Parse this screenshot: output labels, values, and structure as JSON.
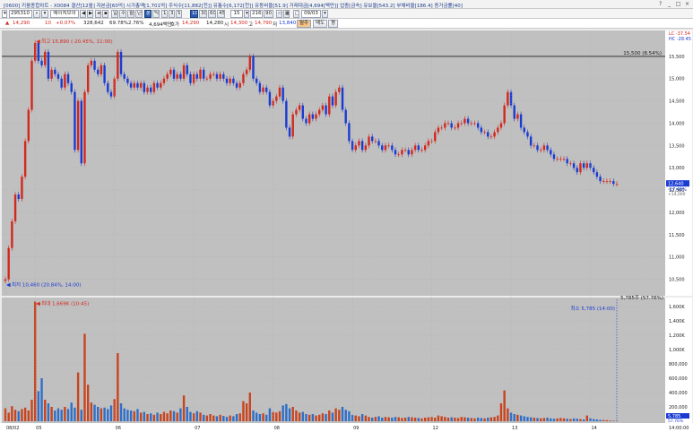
{
  "header": {
    "info_text": "[0600] 키움종합차트 - X0084 결산[12월] 자본금[60억] 시가총액[1,701억] 주식수[11,882[천]] 유통수[6,172[천]] 유동비율[51.9] 거래대금[4,694[백만]] 업종[금속] 유보율[543.2] 부채비율[186.4] 증거금률[40]",
    "buttons": [
      "?",
      "_",
      "□",
      "×"
    ]
  },
  "toolbar": {
    "code": "295310",
    "name_button": "에이치브이",
    "timeframes": [
      "1",
      "3",
      "5",
      "10",
      "30",
      "60",
      "45",
      "15"
    ],
    "interval_value": "15",
    "count_value": "216",
    "unit_label": "90",
    "date_value": "09/03"
  },
  "quote": {
    "price": "14,290",
    "change": "10",
    "change_rate": "+0.07%",
    "volume": "328,642",
    "volume_rate": "69.78%",
    "turnover": "2.76%",
    "amount": "4,694백만",
    "amount_label": "호가",
    "open": "14,290",
    "high_label": "14,280",
    "sise_label": "시",
    "s_value": "14,300",
    "h_label": "고",
    "h_value": "14,790",
    "l_label": "저",
    "l_value": "13,840",
    "btn_orange": "월주",
    "btn_a": "매도",
    "btn_b": "평"
  },
  "price_axis": {
    "ticks": [
      "15,500",
      "15,000",
      "14,500",
      "14,000",
      "13,500",
      "13,000",
      "12,500",
      "12,000",
      "11,500",
      "11,000",
      "10,500"
    ],
    "current_label": "12,640",
    "current_rate": "-17.48%",
    "current_sub": "+14,000",
    "lc_label": "LC -37.54",
    "hc_label": "HC -28.45"
  },
  "volume_axis": {
    "ticks": [
      "1,600K",
      "1,400K",
      "1,200K",
      "1,000K",
      "800,000",
      "600,000",
      "400,000",
      "200,000"
    ],
    "current_label": "5,785",
    "current_rate": "57.76%"
  },
  "annotations": {
    "high": "최고 15,890 (-20.45%, 11:00)",
    "low": "최저 10,460 (20.84%, 14:00)",
    "line_level": "15,500 (8.54%)",
    "vol_max": "최대 1,669K (10:45)",
    "vol_min": "최소 5,785 (14:00)",
    "vol_top_right": "5,785주 (57.76%)"
  },
  "x_axis": {
    "labels": [
      "08/02",
      "05",
      "06",
      "07",
      "08",
      "09",
      "12",
      "13",
      "14"
    ],
    "time_label": "14:00:00"
  },
  "chart_data": {
    "type": "candlestick",
    "title": "",
    "ylim": [
      10250,
      16000
    ],
    "volume_ylim": [
      0,
      1700000
    ],
    "reference_line": 15500,
    "up_color": "#d2281e",
    "down_color": "#1a3bd2",
    "volume_up_color": "#c8441e",
    "volume_down_color": "#2e6fc8",
    "bg_color": "#c0c0c0",
    "x_labels": [
      {
        "bar": 0,
        "text": "08/02"
      },
      {
        "bar": 9,
        "text": "05"
      },
      {
        "bar": 33,
        "text": "06"
      },
      {
        "bar": 57,
        "text": "07"
      },
      {
        "bar": 81,
        "text": "08"
      },
      {
        "bar": 105,
        "text": "09"
      },
      {
        "bar": 129,
        "text": "12"
      },
      {
        "bar": 153,
        "text": "13"
      },
      {
        "bar": 177,
        "text": "14"
      }
    ],
    "close": [
      10500,
      11200,
      11800,
      12400,
      12300,
      12800,
      13600,
      14300,
      15400,
      15800,
      15400,
      15300,
      15600,
      15000,
      15200,
      15100,
      15000,
      14800,
      15100,
      14900,
      14700,
      13400,
      14500,
      13100,
      14700,
      15300,
      15400,
      15200,
      15100,
      15300,
      14900,
      14700,
      14600,
      15000,
      15600,
      15100,
      15000,
      14900,
      14800,
      14900,
      14800,
      14900,
      14700,
      14800,
      14700,
      14900,
      14800,
      14900,
      15000,
      15100,
      15200,
      15000,
      15100,
      15000,
      15300,
      15100,
      14900,
      15100,
      15000,
      15200,
      15000,
      15000,
      15100,
      15100,
      15000,
      15100,
      15000,
      14900,
      15000,
      14900,
      14800,
      14900,
      15100,
      15200,
      15500,
      15000,
      14900,
      14700,
      14800,
      14700,
      14400,
      14500,
      14600,
      14800,
      14500,
      13900,
      13700,
      14200,
      14300,
      14400,
      14100,
      14000,
      14200,
      14100,
      14200,
      14300,
      14400,
      14200,
      14600,
      14400,
      14700,
      14800,
      14300,
      14000,
      13600,
      13400,
      13500,
      13600,
      13400,
      13500,
      13700,
      13600,
      13600,
      13500,
      13400,
      13500,
      13500,
      13400,
      13300,
      13300,
      13400,
      13400,
      13300,
      13400,
      13500,
      13400,
      13400,
      13500,
      13600,
      13600,
      13800,
      13900,
      13900,
      14000,
      14000,
      13900,
      13900,
      14000,
      14000,
      14100,
      14000,
      14000,
      14000,
      13900,
      13800,
      13800,
      13700,
      13700,
      13800,
      13900,
      14000,
      14400,
      14700,
      14400,
      14100,
      14200,
      13900,
      13800,
      13700,
      13500,
      13500,
      13400,
      13400,
      13500,
      13400,
      13300,
      13200,
      13200,
      13200,
      13200,
      13100,
      13100,
      13000,
      12900,
      13100,
      13000,
      13100,
      13000,
      12900,
      12800,
      12700,
      12700,
      12700,
      12700,
      12640,
      12640
    ],
    "open": [
      10460,
      10500,
      11200,
      11800,
      12400,
      12300,
      12800,
      13600,
      14300,
      15400,
      15800,
      15400,
      15300,
      15600,
      15000,
      15200,
      15100,
      15000,
      14800,
      15100,
      14900,
      14700,
      13400,
      14500,
      13100,
      14700,
      15300,
      15400,
      15200,
      15100,
      15300,
      14900,
      14700,
      14600,
      15000,
      15600,
      15100,
      15000,
      14900,
      14800,
      14900,
      14800,
      14900,
      14700,
      14800,
      14700,
      14900,
      14800,
      14900,
      15000,
      15100,
      15200,
      15000,
      15100,
      15000,
      15300,
      15100,
      14900,
      15100,
      15000,
      15200,
      15000,
      15000,
      15100,
      15100,
      15000,
      15100,
      15000,
      14900,
      15000,
      14900,
      14800,
      14900,
      15100,
      15200,
      15500,
      15000,
      14900,
      14700,
      14800,
      14700,
      14400,
      14500,
      14600,
      14800,
      14500,
      13900,
      13700,
      14200,
      14300,
      14400,
      14100,
      14000,
      14200,
      14100,
      14200,
      14300,
      14400,
      14200,
      14600,
      14400,
      14700,
      14800,
      14300,
      14000,
      13600,
      13400,
      13500,
      13600,
      13400,
      13500,
      13700,
      13600,
      13600,
      13500,
      13400,
      13500,
      13500,
      13400,
      13300,
      13300,
      13400,
      13400,
      13300,
      13400,
      13500,
      13400,
      13400,
      13500,
      13600,
      13600,
      13800,
      13900,
      13900,
      14000,
      14000,
      13900,
      13900,
      14000,
      14000,
      14100,
      14000,
      14000,
      14000,
      13900,
      13800,
      13800,
      13700,
      13700,
      13800,
      13900,
      14000,
      14400,
      14700,
      14400,
      14100,
      14200,
      13900,
      13800,
      13700,
      13500,
      13500,
      13400,
      13400,
      13500,
      13400,
      13300,
      13200,
      13200,
      13200,
      13200,
      13100,
      13100,
      13000,
      12900,
      13100,
      13000,
      13100,
      13000,
      12900,
      12800,
      12700,
      12700,
      12700,
      12700,
      12640
    ],
    "volume": [
      180000,
      120000,
      210000,
      160000,
      140000,
      170000,
      190000,
      150000,
      300000,
      1669000,
      420000,
      600000,
      300000,
      250000,
      200000,
      150000,
      180000,
      160000,
      200000,
      170000,
      260000,
      190000,
      680000,
      160000,
      1220000,
      510000,
      260000,
      230000,
      200000,
      180000,
      190000,
      170000,
      220000,
      310000,
      950000,
      250000,
      180000,
      160000,
      150000,
      140000,
      170000,
      120000,
      130000,
      100000,
      110000,
      90000,
      120000,
      100000,
      130000,
      110000,
      150000,
      140000,
      120000,
      180000,
      360000,
      200000,
      130000,
      110000,
      140000,
      120000,
      90000,
      80000,
      100000,
      80000,
      70000,
      90000,
      75000,
      60000,
      80000,
      70000,
      100000,
      110000,
      280000,
      250000,
      400000,
      150000,
      120000,
      100000,
      110000,
      90000,
      180000,
      130000,
      120000,
      140000,
      220000,
      240000,
      180000,
      200000,
      150000,
      120000,
      130000,
      100000,
      90000,
      100000,
      80000,
      90000,
      110000,
      100000,
      150000,
      120000,
      180000,
      160000,
      200000,
      160000,
      140000,
      90000,
      80000,
      70000,
      100000,
      80000,
      60000,
      50000,
      60000,
      70000,
      50000,
      60000,
      55000,
      50000,
      60000,
      55000,
      45000,
      50000,
      60000,
      55000,
      50000,
      45000,
      40000,
      50000,
      55000,
      60000,
      50000,
      80000,
      70000,
      60000,
      50000,
      55000,
      50000,
      45000,
      60000,
      55000,
      50000,
      45000,
      40000,
      50000,
      45000,
      40000,
      50000,
      55000,
      60000,
      80000,
      250000,
      430000,
      180000,
      120000,
      100000,
      90000,
      80000,
      70000,
      60000,
      55000,
      50000,
      45000,
      40000,
      45000,
      50000,
      40000,
      35000,
      40000,
      45000,
      40000,
      35000,
      30000,
      40000,
      35000,
      30000,
      25000,
      80000,
      40000,
      30000,
      25000,
      20000,
      18000,
      15000,
      10000,
      8000,
      5785
    ]
  }
}
